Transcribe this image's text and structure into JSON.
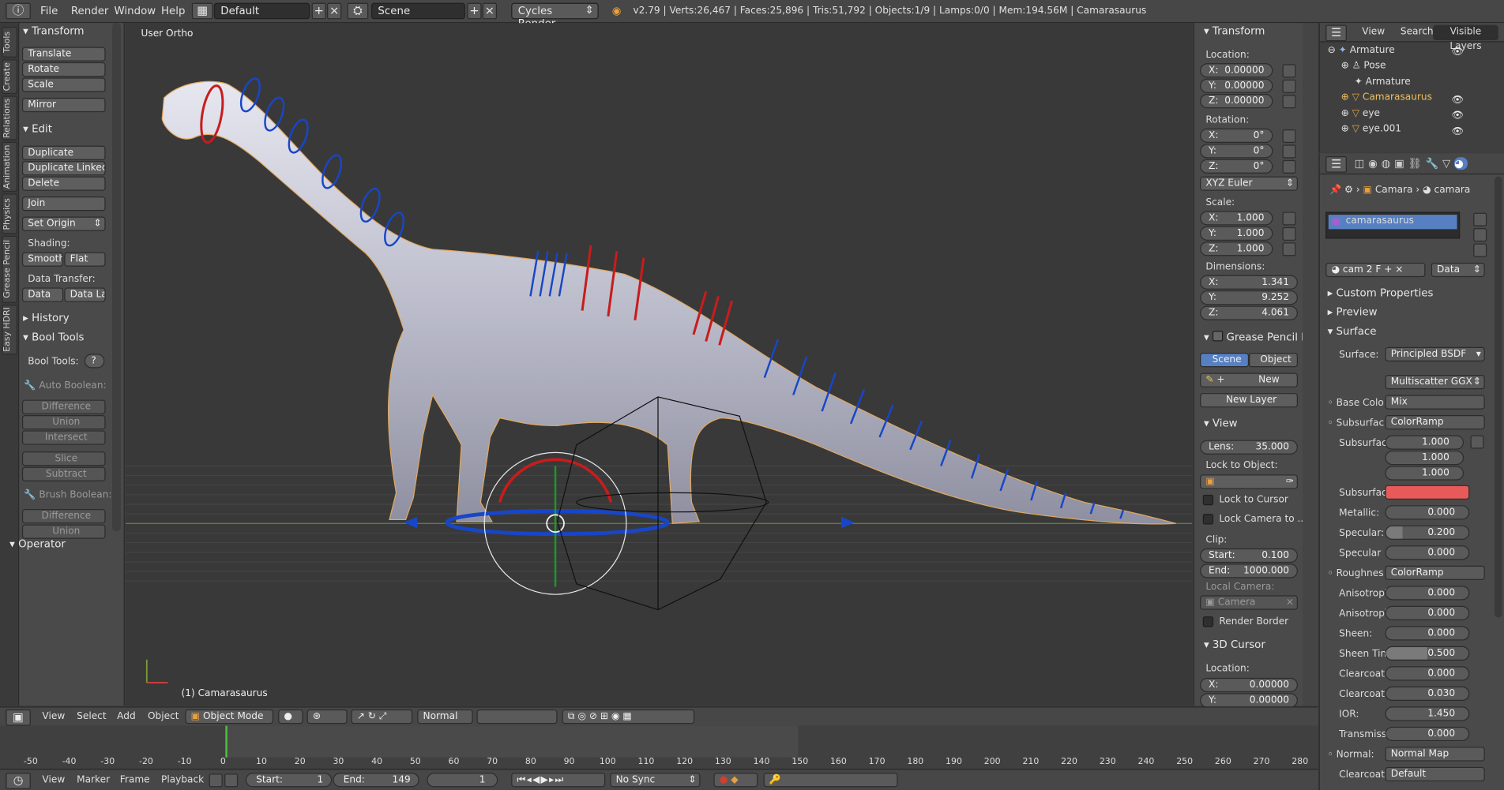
{
  "topbar": {
    "menus": [
      "File",
      "Render",
      "Window",
      "Help"
    ],
    "layout": "Default",
    "scene": "Scene",
    "engine": "Cycles Render",
    "stats": "v2.79 | Verts:26,467 | Faces:25,896 | Tris:51,792 | Objects:1/9 | Lamps:0/0 | Mem:194.56M | Camarasaurus"
  },
  "tool_tabs": [
    "Tools",
    "Create",
    "Relations",
    "Animation",
    "Physics",
    "Grease Pencil",
    "Easy HDRI"
  ],
  "toolshelf": {
    "transform_header": "Transform",
    "transform_buttons": [
      "Translate",
      "Rotate",
      "Scale",
      "Mirror"
    ],
    "edit_header": "Edit",
    "edit_buttons": [
      "Duplicate",
      "Duplicate Linked",
      "Delete",
      "Join"
    ],
    "set_origin": "Set Origin",
    "shading_label": "Shading:",
    "smooth": "Smooth",
    "flat": "Flat",
    "data_transfer_label": "Data Transfer:",
    "data": "Data",
    "data_la": "Data La",
    "history_header": "History",
    "bool_header": "Bool Tools",
    "bool_tools_label": "Bool Tools:",
    "help": "?",
    "auto_boolean": "Auto Boolean:",
    "auto_items": [
      "Difference",
      "Union",
      "Intersect",
      "Slice",
      "Subtract"
    ],
    "brush_boolean": "Brush Boolean:",
    "brush_items": [
      "Difference",
      "Union"
    ],
    "operator_header": "Operator"
  },
  "viewport": {
    "view_name": "User Ortho",
    "object_label": "(1) Camarasaurus"
  },
  "npanel": {
    "transform_header": "Transform",
    "location_label": "Location:",
    "location": [
      {
        "k": "X:",
        "v": "0.00000"
      },
      {
        "k": "Y:",
        "v": "0.00000"
      },
      {
        "k": "Z:",
        "v": "0.00000"
      }
    ],
    "rotation_label": "Rotation:",
    "rotation": [
      {
        "k": "X:",
        "v": "0°"
      },
      {
        "k": "Y:",
        "v": "0°"
      },
      {
        "k": "Z:",
        "v": "0°"
      }
    ],
    "rotation_mode": "XYZ Euler",
    "scale_label": "Scale:",
    "scale": [
      {
        "k": "X:",
        "v": "1.000"
      },
      {
        "k": "Y:",
        "v": "1.000"
      },
      {
        "k": "Z:",
        "v": "1.000"
      }
    ],
    "dimensions_label": "Dimensions:",
    "dimensions": [
      {
        "k": "X:",
        "v": "1.341"
      },
      {
        "k": "Y:",
        "v": "9.252"
      },
      {
        "k": "Z:",
        "v": "4.061"
      }
    ],
    "grease_header": "Grease Pencil La",
    "scene_tab": "Scene",
    "object_tab": "Object",
    "new_btn": "New",
    "new_layer": "New Layer",
    "view_header": "View",
    "lens_label": "Lens:",
    "lens": "35.000",
    "lock_label": "Lock to Object:",
    "lock_cursor": "Lock to Cursor",
    "lock_camera": "Lock Camera to ...",
    "clip_label": "Clip:",
    "clip_start_label": "Start:",
    "clip_start": "0.100",
    "clip_end_label": "End:",
    "clip_end": "1000.000",
    "local_camera": "Local Camera:",
    "camera": "Camera",
    "render_border": "Render Border",
    "cursor_header": "3D Cursor",
    "cursor_location_label": "Location:",
    "cursor_location": [
      {
        "k": "X:",
        "v": "0.00000"
      },
      {
        "k": "Y:",
        "v": "0.00000"
      }
    ]
  },
  "outliner": {
    "menus": [
      "View",
      "Search"
    ],
    "filter": "Visible Layers",
    "items": [
      {
        "name": "Armature"
      },
      {
        "name": "Pose"
      },
      {
        "name": "Armature"
      },
      {
        "name": "Camarasaurus"
      },
      {
        "name": "eye"
      },
      {
        "name": "eye.001"
      }
    ]
  },
  "properties": {
    "breadcrumb_object": "Camara",
    "breadcrumb_material": "camara",
    "material_slot": "camarasaurus",
    "mat_name": "cam",
    "mat_users": "2",
    "mat_f": "F",
    "link": "Data",
    "custom_properties": "Custom Properties",
    "preview": "Preview",
    "surface_header": "Surface",
    "surface_label": "Surface:",
    "surface_shader": "Principled BSDF",
    "distribution": "Multiscatter GGX",
    "rows": [
      {
        "label": "Base Colo",
        "value": "Mix"
      },
      {
        "label": "Subsurfac",
        "value": "ColorRamp"
      }
    ],
    "subsurface_label": "Subsurfac",
    "subsurface_radius": [
      "1.000",
      "1.000",
      "1.000"
    ],
    "subsurface_color_label": "Subsurfac",
    "subsurface_color": "#e85a5a",
    "metallic_label": "Metallic:",
    "metallic": "0.000",
    "specular_label": "Specular:",
    "specular": "0.200",
    "specular_tint_label": "Specular",
    "specular_tint": "0.000",
    "roughness_label": "Roughnes",
    "roughness": "ColorRamp",
    "aniso_label": "Anisotropi",
    "aniso": "0.000",
    "aniso_rot_label": "Anisotropi",
    "aniso_rot": "0.000",
    "sheen_label": "Sheen:",
    "sheen": "0.000",
    "sheen_tint_label": "Sheen Tin",
    "sheen_tint": "0.500",
    "clearcoat_label": "Clearcoat:",
    "clearcoat": "0.000",
    "clearcoat_rough_label": "Clearcoat",
    "clearcoat_rough": "0.030",
    "ior_label": "IOR:",
    "ior": "1.450",
    "transmission_label": "Transmiss",
    "transmission": "0.000",
    "normal_label": "Normal:",
    "normal": "Normal Map",
    "clearcoat_normal_label": "Clearcoat",
    "clearcoat_normal": "Default"
  },
  "viewport_header": {
    "menus": [
      "View",
      "Select",
      "Add",
      "Object"
    ],
    "mode": "Object Mode",
    "orientation": "Normal"
  },
  "timeline": {
    "ticks": [
      "-50",
      "-40",
      "-30",
      "-20",
      "-10",
      "0",
      "10",
      "20",
      "30",
      "40",
      "50",
      "60",
      "70",
      "80",
      "90",
      "100",
      "110",
      "120",
      "130",
      "140",
      "150",
      "160",
      "170",
      "180",
      "190",
      "200",
      "210",
      "220",
      "230",
      "240",
      "250",
      "260",
      "270",
      "280"
    ],
    "menus": [
      "View",
      "Marker",
      "Frame",
      "Playback"
    ],
    "start_label": "Start:",
    "start": "1",
    "end_label": "End:",
    "end": "149",
    "current": "1",
    "sync": "No Sync"
  }
}
